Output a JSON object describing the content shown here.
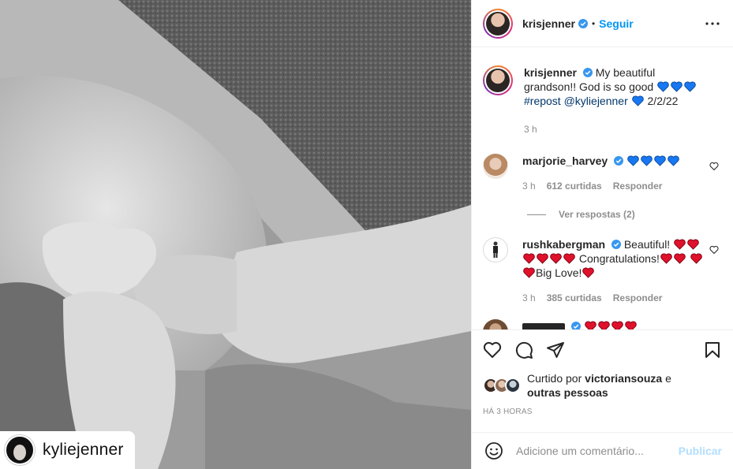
{
  "photo": {
    "alt_icon": "baby-hands-photo",
    "repost_tag": {
      "username": "kyliejenner"
    }
  },
  "header": {
    "username": "krisjenner",
    "separator": "•",
    "follow_label": "Seguir",
    "more_icon": "more-horizontal-icon"
  },
  "caption": {
    "username": "krisjenner",
    "text_a": "My beautiful grandson!! God is so good",
    "hashtag": "#repost",
    "mention": "@kyliejenner",
    "date": "2/2/22",
    "time": "3 h"
  },
  "comments": [
    {
      "username": "marjorie_harvey",
      "hearts": 4,
      "heart_color": "blue",
      "time": "3 h",
      "likes": "612 curtidas",
      "reply": "Responder",
      "view_replies": "Ver respostas (2)"
    },
    {
      "username": "rushkabergman",
      "t1": "Beautiful!",
      "t2": "Congratulations!",
      "t3": "Big Love!",
      "time": "3 h",
      "likes": "385 curtidas",
      "reply": "Responder"
    }
  ],
  "actions": {
    "liked_prefix": "Curtido por",
    "liked_user": "victoriansouza",
    "liked_and": "e",
    "liked_others": "outras pessoas",
    "time_ago": "HÁ 3 HORAS"
  },
  "add_comment": {
    "placeholder": "Adicione um comentário...",
    "post_label": "Publicar"
  },
  "colors": {
    "accent": "#0095f6",
    "blue_heart": "#1877f2",
    "red_heart": "#e0112b",
    "muted": "#8e8e8e"
  }
}
